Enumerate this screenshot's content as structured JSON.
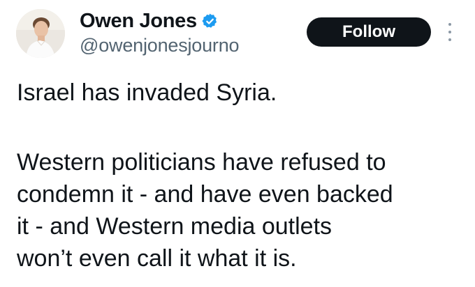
{
  "author": {
    "display_name": "Owen Jones",
    "handle": "@owenjonesjourno",
    "verified": true,
    "verified_icon": "verified-badge-icon",
    "verified_color": "#1d9bf0"
  },
  "actions": {
    "follow_label": "Follow",
    "more_icon": "more-options-icon"
  },
  "tweet": {
    "paragraph_1": "Israel has invaded Syria.",
    "paragraph_2_lines": [
      "Western politicians have refused to",
      "condemn it - and have even backed",
      "it - and Western media outlets",
      "won’t even call it what it is."
    ]
  },
  "colors": {
    "text_primary": "#0f1419",
    "text_secondary": "#536471",
    "button_bg": "#0f1419",
    "button_text": "#ffffff"
  }
}
